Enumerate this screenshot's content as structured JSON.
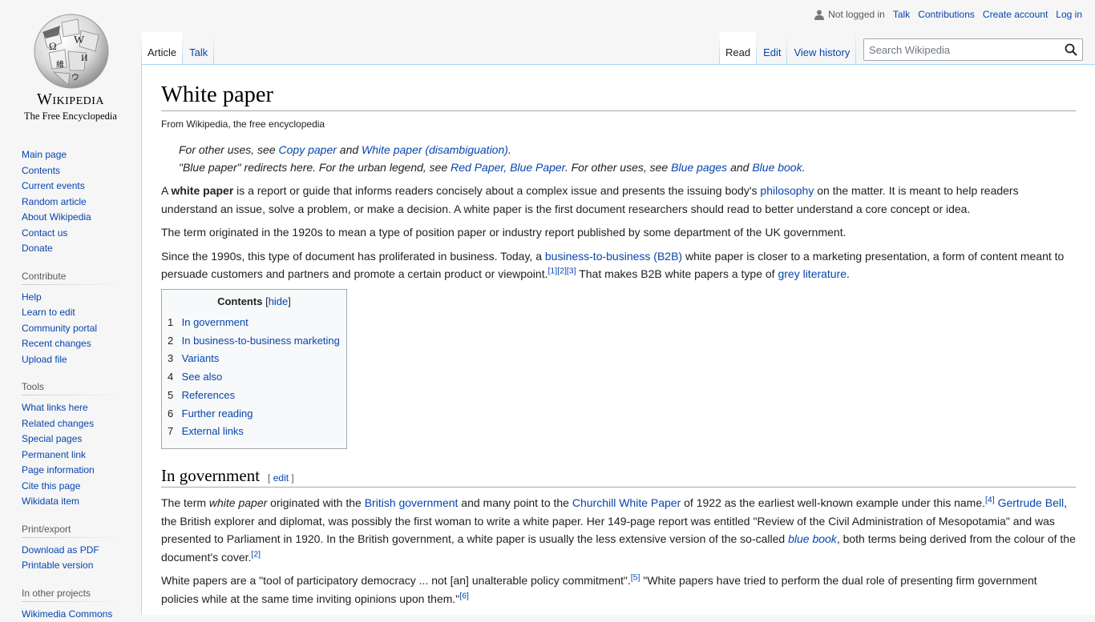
{
  "logo": {
    "wordmark": "Wikipedia",
    "tagline": "The Free Encyclopedia"
  },
  "personal": {
    "anon": "Not logged in",
    "links": [
      "Talk",
      "Contributions",
      "Create account",
      "Log in"
    ]
  },
  "tabs": {
    "left": [
      "Article",
      "Talk"
    ],
    "right": [
      "Read",
      "Edit",
      "View history"
    ]
  },
  "search": {
    "placeholder": "Search Wikipedia"
  },
  "sidebar": {
    "navigation": [
      "Main page",
      "Contents",
      "Current events",
      "Random article",
      "About Wikipedia",
      "Contact us",
      "Donate"
    ],
    "contribute": {
      "heading": "Contribute",
      "items": [
        "Help",
        "Learn to edit",
        "Community portal",
        "Recent changes",
        "Upload file"
      ]
    },
    "tools": {
      "heading": "Tools",
      "items": [
        "What links here",
        "Related changes",
        "Special pages",
        "Permanent link",
        "Page information",
        "Cite this page",
        "Wikidata item"
      ]
    },
    "print": {
      "heading": "Print/export",
      "items": [
        "Download as PDF",
        "Printable version"
      ]
    },
    "projects": {
      "heading": "In other projects",
      "items": [
        "Wikimedia Commons"
      ]
    }
  },
  "article": {
    "title": "White paper",
    "site_sub": "From Wikipedia, the free encyclopedia",
    "hatnote1": {
      "t1": "For other uses, see ",
      "l1": "Copy paper",
      "t2": " and ",
      "l2": "White paper (disambiguation)",
      "t3": "."
    },
    "hatnote2": {
      "t1": "\"Blue paper\" redirects here. For the urban legend, see ",
      "l1": "Red Paper, Blue Paper",
      "t2": ". For other uses, see ",
      "l2": "Blue pages",
      "t3": " and ",
      "l3": "Blue book",
      "t4": "."
    },
    "p1": {
      "t1": "A ",
      "b1": "white paper",
      "t2": " is a report or guide that informs readers concisely about a complex issue and presents the issuing body's ",
      "l1": "philosophy",
      "t3": " on the matter. It is meant to help readers understand an issue, solve a problem, or make a decision. A white paper is the first document researchers should read to better understand a core concept or idea."
    },
    "p2": "The term originated in the 1920s to mean a type of position paper or industry report published by some department of the UK government.",
    "p3": {
      "t1": "Since the 1990s, this type of document has proliferated in business. Today, a ",
      "l1": "business-to-business (B2B)",
      "t2": " white paper is closer to a marketing presentation, a form of content meant to persuade customers and partners and promote a certain product or viewpoint.",
      "r1": "[1]",
      "r2": "[2]",
      "r3": "[3]",
      "t3": " That makes B2B white papers a type of ",
      "l2": "grey literature",
      "t4": "."
    },
    "toc": {
      "title": "Contents",
      "hide": "hide",
      "items": [
        {
          "num": "1",
          "label": "In government"
        },
        {
          "num": "2",
          "label": "In business-to-business marketing"
        },
        {
          "num": "3",
          "label": "Variants"
        },
        {
          "num": "4",
          "label": "See also"
        },
        {
          "num": "5",
          "label": "References"
        },
        {
          "num": "6",
          "label": "Further reading"
        },
        {
          "num": "7",
          "label": "External links"
        }
      ]
    },
    "section1": {
      "heading": "In government",
      "edit": "edit",
      "p1": {
        "t1": "The term ",
        "i1": "white paper",
        "t2": " originated with the ",
        "l1": "British government",
        "t3": " and many point to the ",
        "l2": "Churchill White Paper",
        "t4": " of 1922 as the earliest well-known example under this name.",
        "r1": "[4]",
        "t5": " ",
        "l3": "Gertrude Bell",
        "t6": ", the British explorer and diplomat, was possibly the first woman to write a white paper. Her 149-page report was entitled \"Review of the Civil Administration of Mesopotamia\" and was presented to Parliament in 1920. In the British government, a white paper is usually the less extensive version of the so-called ",
        "l4": "blue book",
        "t7": ", both terms being derived from the colour of the document's cover.",
        "r2": "[2]"
      },
      "p2": {
        "t1": "White papers are a \"tool of participatory democracy ... not [an] unalterable policy commitment\".",
        "r1": "[5]",
        "t2": " \"White papers have tried to perform the dual role of presenting firm government policies while at the same time inviting opinions upon them.\"",
        "r2": "[6]"
      }
    }
  }
}
